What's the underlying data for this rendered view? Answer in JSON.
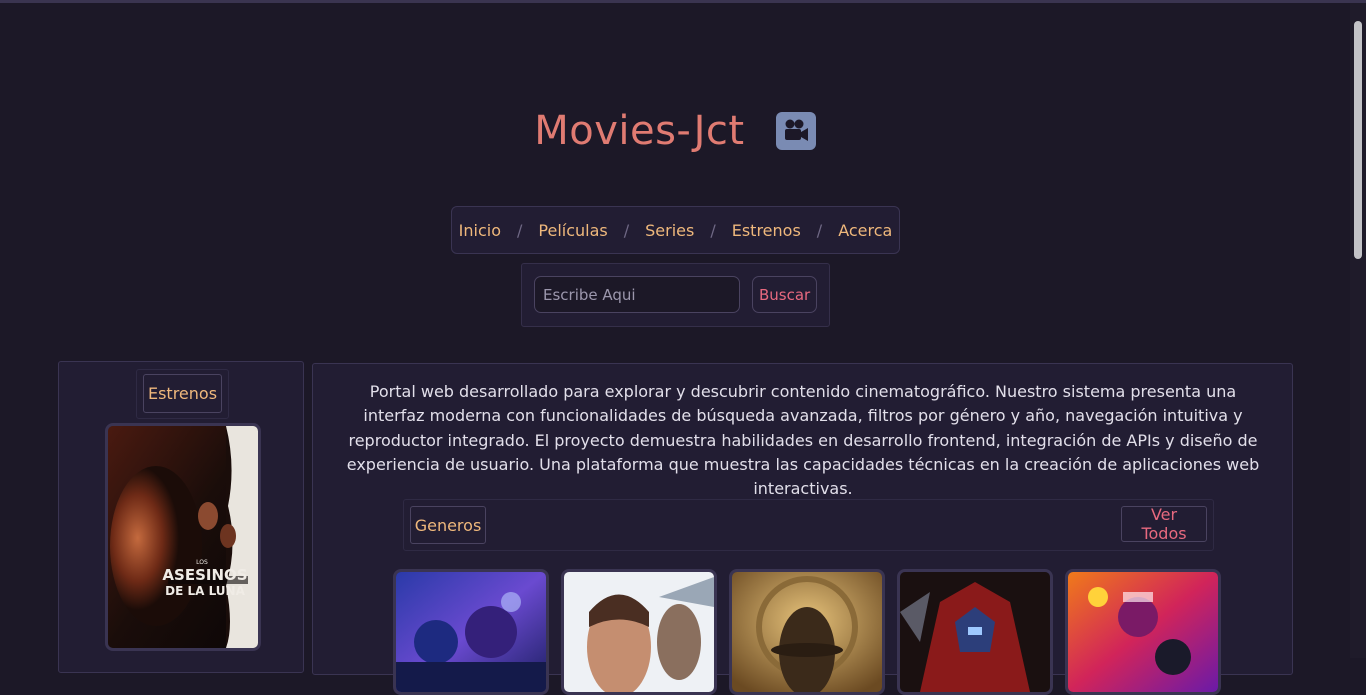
{
  "header": {
    "title": "Movies-Jct",
    "title_icon": "movie-camera-icon"
  },
  "nav": {
    "items": [
      {
        "label": "Inicio"
      },
      {
        "label": "Películas"
      },
      {
        "label": "Series"
      },
      {
        "label": "Estrenos"
      },
      {
        "label": "Acerca"
      }
    ],
    "separator": "/"
  },
  "search": {
    "placeholder": "Escribe Aqui",
    "value": "",
    "button_label": "Buscar"
  },
  "sidebar": {
    "heading": "Estrenos",
    "poster": {
      "title_lines": [
        "LOS",
        "ASESINOS",
        "DE LA LUNA"
      ]
    }
  },
  "main": {
    "description": "Portal web desarrollado para explorar y descubrir contenido cinematográfico. Nuestro sistema presenta una interfaz moderna con funcionalidades de búsqueda avanzada, filtros por género y año, navegación intuitiva y reproductor integrado. El proyecto demuestra habilidades en desarrollo frontend, integración de APIs y diseño de experiencia de usuario. Una plataforma que muestra las capacidades técnicas en la creación de aplicaciones web interactivas.",
    "genres_label": "Generos",
    "see_all_label": "Ver Todos"
  },
  "theme": {
    "background": "#1c1827",
    "panel": "#221d33",
    "title_color": "#e07b72",
    "link_color": "#efb87c",
    "accent_pink": "#e8697f"
  }
}
